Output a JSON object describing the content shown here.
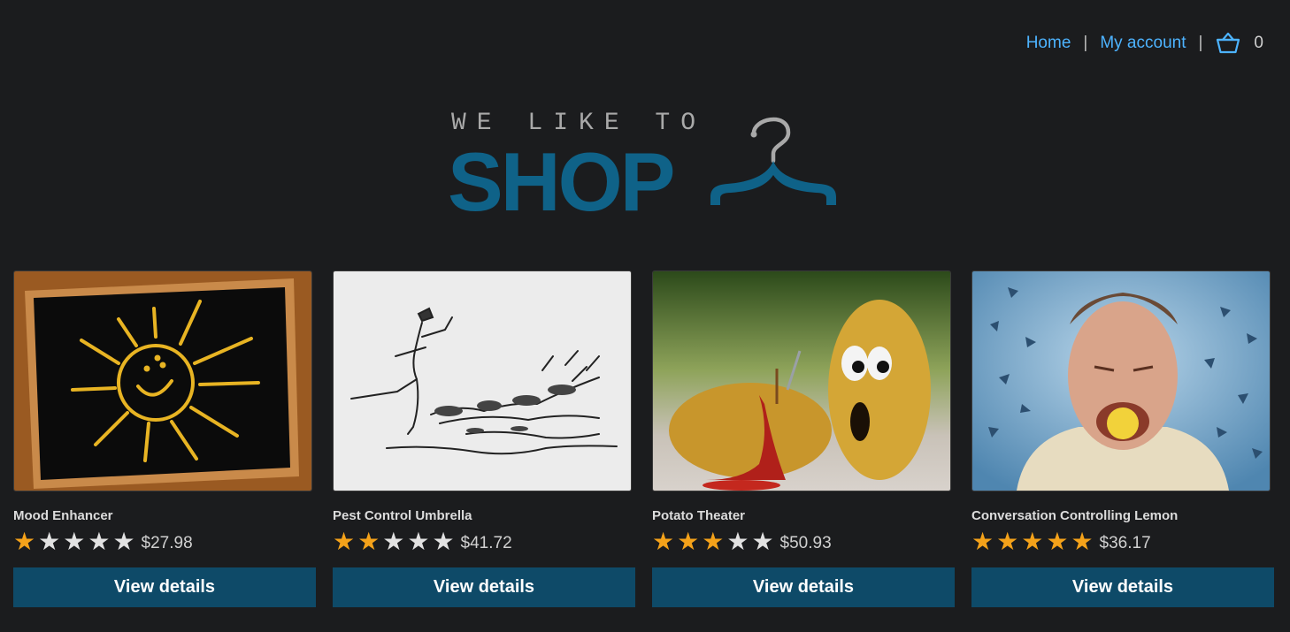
{
  "nav": {
    "home": "Home",
    "account": "My account",
    "separator": "|",
    "cart_icon": "basket-icon",
    "cart_count": "0",
    "link_color": "#4db3ff"
  },
  "logo": {
    "tagline": "WE LIKE TO",
    "brand": "SHOP",
    "icon": "hanger-icon"
  },
  "products": [
    {
      "name": "Mood Enhancer",
      "rating": 1,
      "max_rating": 5,
      "price": "$27.98",
      "button": "View details",
      "image": "chalkboard-sun-image"
    },
    {
      "name": "Pest Control Umbrella",
      "rating": 2,
      "max_rating": 5,
      "price": "$41.72",
      "button": "View details",
      "image": "pied-piper-sketch-image"
    },
    {
      "name": "Potato Theater",
      "rating": 3,
      "max_rating": 5,
      "price": "$50.93",
      "button": "View details",
      "image": "potatoes-image"
    },
    {
      "name": "Conversation Controlling Lemon",
      "rating": 5,
      "max_rating": 5,
      "price": "$36.17",
      "button": "View details",
      "image": "man-with-lemon-image"
    }
  ],
  "colors": {
    "background": "#1b1c1e",
    "brand": "#0f6288",
    "button": "#0e4a68",
    "star_on": "#f4a21a",
    "star_off": "#e2e2e2"
  }
}
